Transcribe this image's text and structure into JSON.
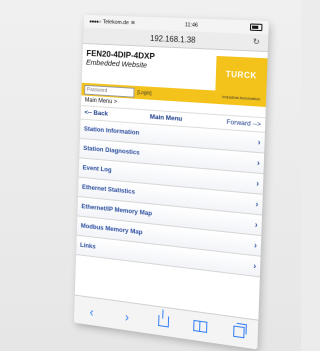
{
  "status_bar": {
    "carrier": "Telekom.de",
    "time": "11:46"
  },
  "browser": {
    "url": "192.168.1.38"
  },
  "header": {
    "model": "FEN20-4DIP-4DXP",
    "subtitle": "Embedded Website",
    "logo_text": "TURCK",
    "tagline": "Industrial Automation"
  },
  "login": {
    "password_placeholder": "Password",
    "login_label": "[Login]"
  },
  "breadcrumb": "Main Menu >",
  "nav": {
    "back": "<-- Back",
    "title": "Main Menu",
    "forward": "Forward -->"
  },
  "menu": {
    "items": [
      {
        "label": "Station Information"
      },
      {
        "label": "Station Diagnostics"
      },
      {
        "label": "Event Log"
      },
      {
        "label": "Ethernet Statistics"
      },
      {
        "label": "Ethernet/IP Memory Map"
      },
      {
        "label": "Modbus Memory Map"
      },
      {
        "label": "Links"
      }
    ]
  },
  "colors": {
    "accent_yellow": "#f3c21b",
    "link_blue": "#2c4e9e",
    "ios_blue": "#2e7cf6"
  },
  "icons": {
    "back": "chevron-left",
    "forward": "chevron-right",
    "share": "share-icon",
    "bookmarks": "book-icon",
    "tabs": "tabs-icon"
  }
}
